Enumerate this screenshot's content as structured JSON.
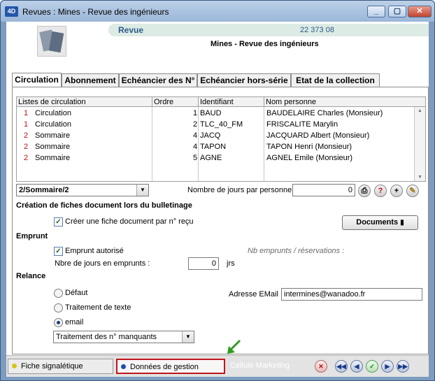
{
  "window": {
    "title": "Revues : Mines - Revue des ingénieurs",
    "app_icon": "4D"
  },
  "header": {
    "label": "Revue",
    "number": "22 373 08",
    "title": "Mines - Revue des ingénieurs"
  },
  "tabs": [
    {
      "label": "Circulation",
      "active": true
    },
    {
      "label": "Abonnement"
    },
    {
      "label": "Echéancier des N°"
    },
    {
      "label": "Echéancier hors-série"
    },
    {
      "label": "Etat de la collection"
    }
  ],
  "grid": {
    "headers": [
      "Listes de circulation",
      "Ordre",
      "Identifiant",
      "Nom personne"
    ],
    "rows": [
      {
        "num": "1",
        "list": "Circulation",
        "ordre": "1",
        "id": "BAUD",
        "nom": "BAUDELAIRE Charles (Monsieur)"
      },
      {
        "num": "1",
        "list": "Circulation",
        "ordre": "2",
        "id": "TLC_40_FM",
        "nom": "FRISCALITE Marylin"
      },
      {
        "num": "2",
        "list": "Sommaire",
        "ordre": "4",
        "id": "JACQ",
        "nom": "JACQUARD Albert (Monsieur)"
      },
      {
        "num": "2",
        "list": "Sommaire",
        "ordre": "4",
        "id": "TAPON",
        "nom": "TAPON Henri (Monsieur)"
      },
      {
        "num": "2",
        "list": "Sommaire",
        "ordre": "5",
        "id": "AGNE",
        "nom": "AGNEL Emile (Monsieur)"
      }
    ]
  },
  "list_selector": {
    "value": "2/Sommaire/2"
  },
  "jours_par_personne": {
    "label": "Nombre de jours par personne",
    "value": "0"
  },
  "creation": {
    "section": "Création de fiches document lors du bulletinage",
    "checkbox_label": "Créer une fiche document par n° reçu",
    "documents_button": "Documents"
  },
  "emprunt": {
    "section": "Emprunt",
    "checkbox_label": "Emprunt autorisé",
    "note": "Nb emprunts / réservations :",
    "jours_label": "Nbre de jours en emprunts :",
    "jours_value": "0",
    "unit": "jrs"
  },
  "relance": {
    "section": "Relance",
    "options": [
      "Défaut",
      "Traitement de texte",
      "email"
    ],
    "selected": "email",
    "email_label": "Adresse EMail",
    "email_value": "intermines@wanadoo.fr",
    "treatment_select": "Traitement des n° manquants"
  },
  "bottom": {
    "tab1": "Fiche signalétique",
    "tab2": "Données de gestion",
    "tab3": "Cellule Marketing"
  }
}
